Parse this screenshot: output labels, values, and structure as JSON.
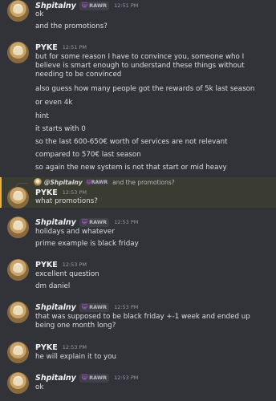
{
  "tag": {
    "icon": "cat-paw-icon",
    "label": "RAWR"
  },
  "messages": [
    {
      "author": "Shpitalny",
      "time": "12:51 PM",
      "lines": [
        "ok",
        "and the promotions?"
      ]
    },
    {
      "author": "PYKE",
      "time": "12:51 PM",
      "lines": [
        "but for some reason I have to convince you, someone who I believe is smart enough to understand these things without needing to be convinced",
        "also guess how many people got the rewards of 5k last season",
        "or even 4k",
        "hint",
        "it starts with 0",
        "so the last 600-650€ worth of services are not relevant",
        "compared to 570€ last season",
        "so again the new system is not that start or mid heavy"
      ]
    },
    {
      "author": "PYKE",
      "time": "12:53 PM",
      "reply": {
        "author": "@Shpitalny",
        "text": "and the promotions?"
      },
      "lines": [
        "what promotions?"
      ]
    },
    {
      "author": "Shpitalny",
      "time": "12:53 PM",
      "lines": [
        "holidays and whatever",
        "prime example is black friday"
      ]
    },
    {
      "author": "PYKE",
      "time": "12:53 PM",
      "lines": [
        "excellent question",
        "dm daniel"
      ]
    },
    {
      "author": "Shpitalny",
      "time": "12:53 PM",
      "lines": [
        "that was supposed to be black friday +-1 week and ended up being one month long?"
      ]
    },
    {
      "author": "PYKE",
      "time": "12:53 PM",
      "lines": [
        "he will explain it to you"
      ]
    },
    {
      "author": "Shpitalny",
      "time": "12:53 PM",
      "lines": [
        "ok"
      ]
    }
  ]
}
